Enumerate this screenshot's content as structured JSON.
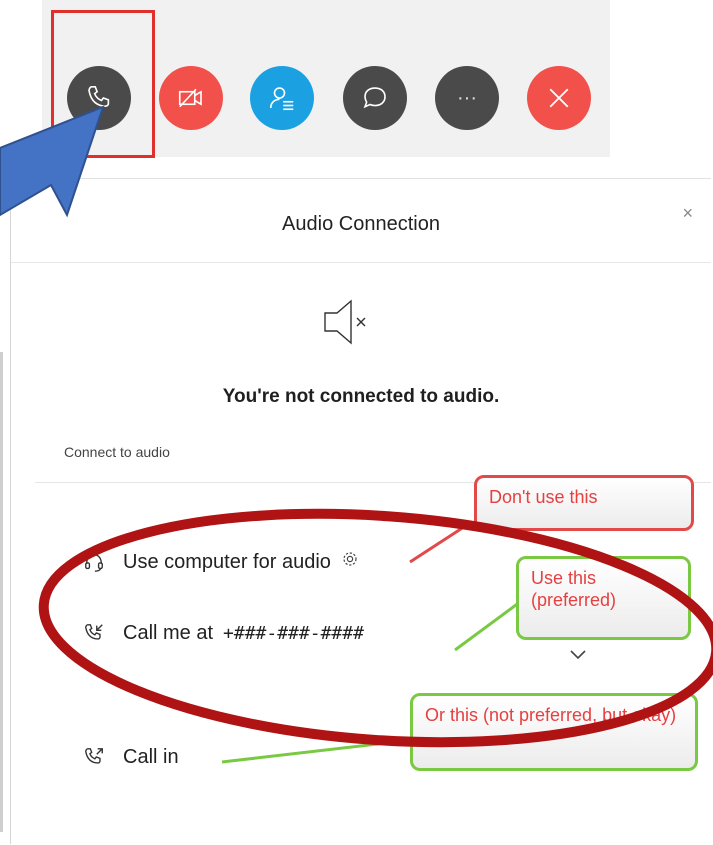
{
  "toolbar": {
    "buttons": [
      {
        "name": "audio-button",
        "icon": "phone-icon",
        "color": "#4a4a4a"
      },
      {
        "name": "video-button",
        "icon": "video-off-icon",
        "color": "#f2504b"
      },
      {
        "name": "participants-button",
        "icon": "participants-icon",
        "color": "#1ba1e2"
      },
      {
        "name": "chat-button",
        "icon": "chat-icon",
        "color": "#4a4a4a"
      },
      {
        "name": "more-button",
        "icon": "more-icon",
        "color": "#4a4a4a"
      },
      {
        "name": "leave-button",
        "icon": "close-icon",
        "color": "#f2504b"
      }
    ],
    "more_glyph": "···"
  },
  "dialog": {
    "title": "Audio Connection",
    "close": "×",
    "status": "You're not connected to audio.",
    "section_label": "Connect to audio",
    "options": [
      {
        "label": "Use computer for audio",
        "icon": "headset-icon",
        "extra_icon": "gear-icon"
      },
      {
        "label": "Call me at",
        "number": "+###-###-####",
        "icon": "phone-incoming-icon"
      },
      {
        "label": "Call in",
        "icon": "phone-outgoing-icon"
      }
    ]
  },
  "annotations": {
    "red_note": "Don't use this",
    "green_note_1": "Use this (preferred)",
    "green_note_2": "Or this (not preferred, but okay)",
    "colors": {
      "red": "#e24a4a",
      "green": "#7ac943",
      "ellipse": "#b01313",
      "arrow": "#4472c4"
    }
  }
}
